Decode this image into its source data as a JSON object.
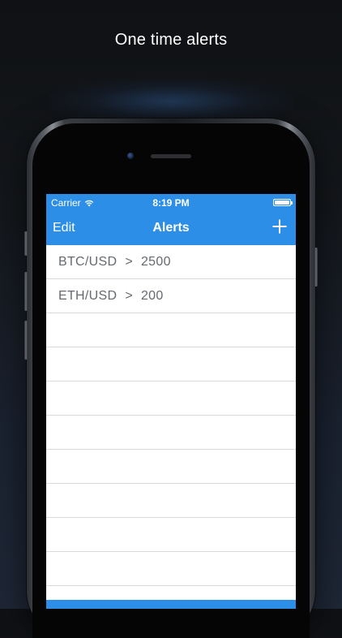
{
  "headline": "One time alerts",
  "status_bar": {
    "carrier": "Carrier",
    "time": "8:19 PM",
    "battery_level": 1.0
  },
  "navbar": {
    "edit_label": "Edit",
    "title": "Alerts",
    "add_icon": "plus-icon"
  },
  "alerts": [
    {
      "pair": "BTC/USD",
      "operator": ">",
      "value": "2500"
    },
    {
      "pair": "ETH/USD",
      "operator": ">",
      "value": "200"
    }
  ],
  "colors": {
    "accent": "#2c8ee6",
    "row_text": "#666a70",
    "separator": "#d9d9d9"
  }
}
